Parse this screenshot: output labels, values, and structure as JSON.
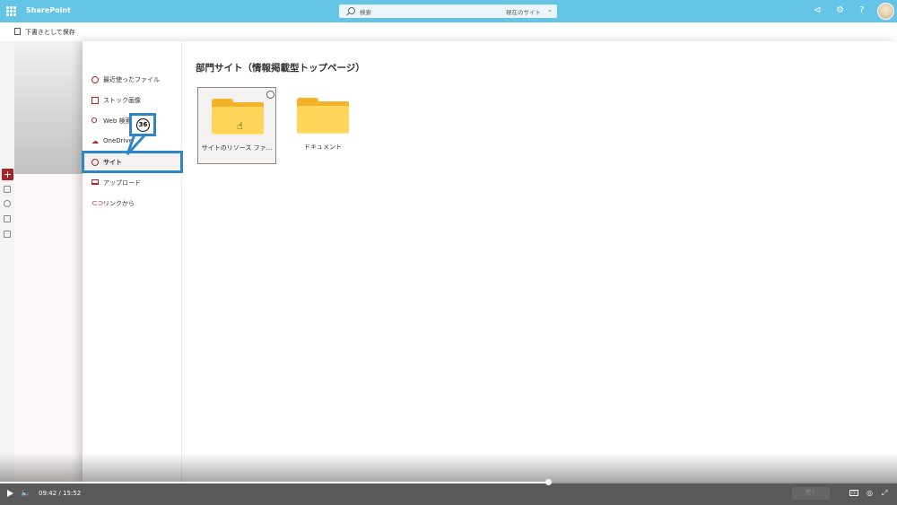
{
  "app": {
    "brand": "SharePoint"
  },
  "search": {
    "placeholder": "検索",
    "scope": "現在のサイト"
  },
  "header_icons": [
    "megaphone-icon",
    "gear-icon",
    "help-icon",
    "avatar"
  ],
  "page": {
    "save_draft": "下書きとして保存"
  },
  "file_picker": {
    "nav": [
      {
        "icon": "clock-icon",
        "label": "最近使ったファイル"
      },
      {
        "icon": "image-icon",
        "label": "ストック画像"
      },
      {
        "icon": "search-icon",
        "label": "Web 検索"
      },
      {
        "icon": "cloud-icon",
        "label": "OneDrive"
      },
      {
        "icon": "globe-icon",
        "label": "サイト",
        "selected": true
      },
      {
        "icon": "laptop-icon",
        "label": "アップロード"
      },
      {
        "icon": "link-icon",
        "label": "リンクから"
      }
    ],
    "content_title": "部門サイト（情報掲載型トップページ）",
    "items": [
      {
        "label": "サイトのリソース ファ...",
        "selected": true
      },
      {
        "label": "ドキュメント",
        "selected": false
      }
    ]
  },
  "annotation": {
    "step_number": "36"
  },
  "video": {
    "current_time": "09:42",
    "separator": "/",
    "total_time": "15:52",
    "progress_fraction": 0.611,
    "ghost_button": "閉く"
  },
  "colors": {
    "topbar": "#64c5e6",
    "accent": "#a4262c",
    "annotation": "#2e86c9",
    "folder": "#ffd55a"
  }
}
